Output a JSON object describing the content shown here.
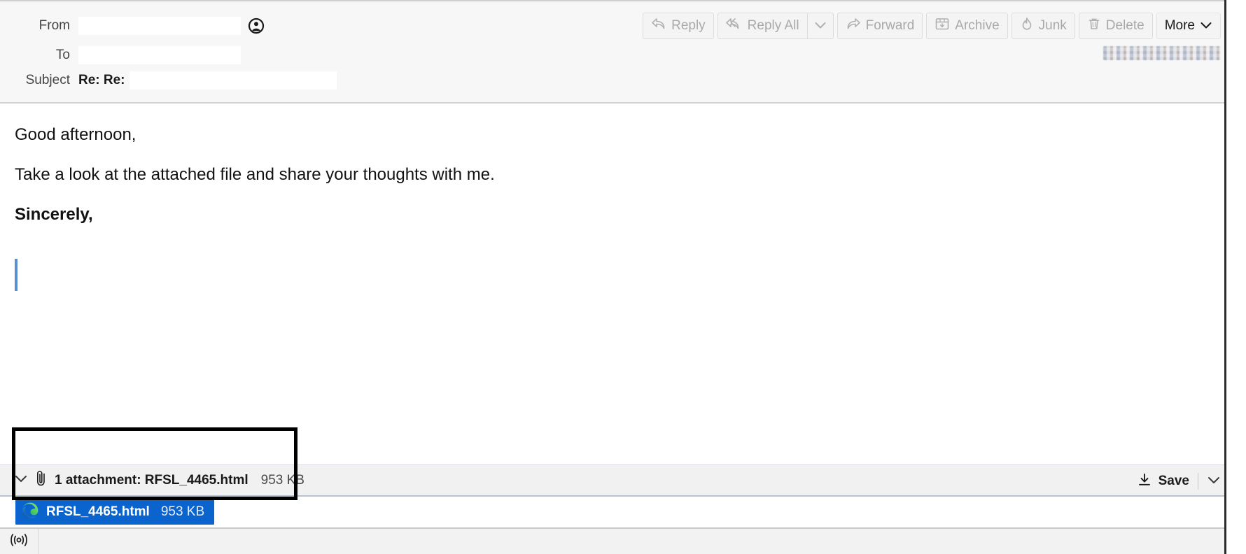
{
  "header": {
    "fields": [
      {
        "label": "From",
        "value": "",
        "redacted": true,
        "icon": "contact-circle-icon"
      },
      {
        "label": "To",
        "value": "",
        "redacted": true
      },
      {
        "label": "Subject",
        "value": "Re: Re:",
        "redacted": true
      }
    ],
    "timestamp": "",
    "timestamp_redacted": true
  },
  "toolbar": {
    "reply_label": "Reply",
    "reply_all_label": "Reply All",
    "reply_all_chevron": "chevron-down-icon",
    "forward_label": "Forward",
    "archive_label": "Archive",
    "junk_label": "Junk",
    "delete_label": "Delete",
    "more_label": "More",
    "more_chevron": "chevron-down-icon"
  },
  "message": {
    "lines": [
      "Good afternoon,",
      "Take a look at the attached file and share your thoughts with me.",
      "Sincerely,"
    ],
    "quote_marker_color": "#5a8fcf"
  },
  "attachments": {
    "summary_text": "1 attachment: RFSL_4465.html",
    "summary_size": "953 KB",
    "save_label": "Save",
    "save_chevron": "chevron-down-icon",
    "twisty": "chevron-down-icon",
    "clip_icon": "paperclip-icon",
    "download_icon": "download-icon",
    "items": [
      {
        "name": "RFSL_4465.html",
        "size": "953 KB",
        "icon": "edge-browser-icon",
        "selected": true,
        "selected_color": "#0b63ce"
      }
    ]
  },
  "status_bar": {
    "icon": "broadcast-signal-icon"
  },
  "colors": {
    "header_bg": "#f7f7f7",
    "body_bg": "#ffffff",
    "attach_bar_bg": "#f1f1f1",
    "selection_blue": "#0b63ce",
    "annotation_outline": "#000000",
    "disabled_text": "#a9a9a9"
  }
}
